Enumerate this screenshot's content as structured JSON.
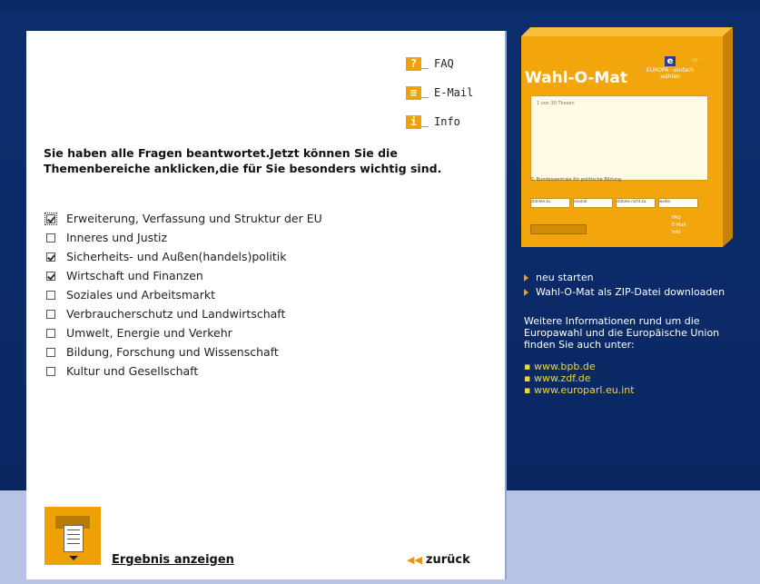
{
  "top_links": [
    {
      "icon": "?",
      "label": "FAQ"
    },
    {
      "icon": "≡",
      "label": "E-Mail"
    },
    {
      "icon": "i",
      "label": "Info"
    }
  ],
  "instruction": "Sie haben alle Fragen beantwortet.Jetzt können Sie die Themenbereiche anklicken,die für Sie besonders wichtig sind.",
  "topics": [
    {
      "label": "Erweiterung, Verfassung und Struktur der EU",
      "checked": true
    },
    {
      "label": "Inneres und Justiz",
      "checked": false
    },
    {
      "label": "Sicherheits- und Außen(handels)politik",
      "checked": true
    },
    {
      "label": "Wirtschaft und Finanzen",
      "checked": true
    },
    {
      "label": "Soziales und Arbeitsmarkt",
      "checked": false
    },
    {
      "label": "Verbraucherschutz und Landwirtschaft",
      "checked": false
    },
    {
      "label": "Umwelt, Energie und Verkehr",
      "checked": false
    },
    {
      "label": "Bildung, Forschung und Wissenschaft",
      "checked": false
    },
    {
      "label": "Kultur und Gesellschaft",
      "checked": false
    }
  ],
  "result_button": "Ergebnis anzeigen",
  "back_button": "zurück",
  "preview_box": {
    "title": "Wahl-O-Mat",
    "logo_text": "EUROPA · einfach wählen",
    "screen_text": "1 von 30 Thesen",
    "footer_text": "© Bundeszentrale für politische Bildung",
    "tabs": [
      "stimme zu",
      "neutral",
      "stimme nicht zu",
      "weiter"
    ],
    "mini_links": [
      "FAQ",
      "E-Mail",
      "Info"
    ]
  },
  "side_links": [
    "neu starten",
    "Wahl-O-Mat als ZIP-Datei downloaden"
  ],
  "side_info": "Weitere Informationen rund um die Europawahl und die Europäische Union finden Sie auch unter:",
  "side_urls": [
    "www.bpb.de",
    "www.zdf.de",
    "www.europarl.eu.int"
  ],
  "colors": {
    "accent": "#f2a007",
    "background": "#0b2a68",
    "panel": "#ffffff",
    "link_yellow": "#f1d33c"
  }
}
